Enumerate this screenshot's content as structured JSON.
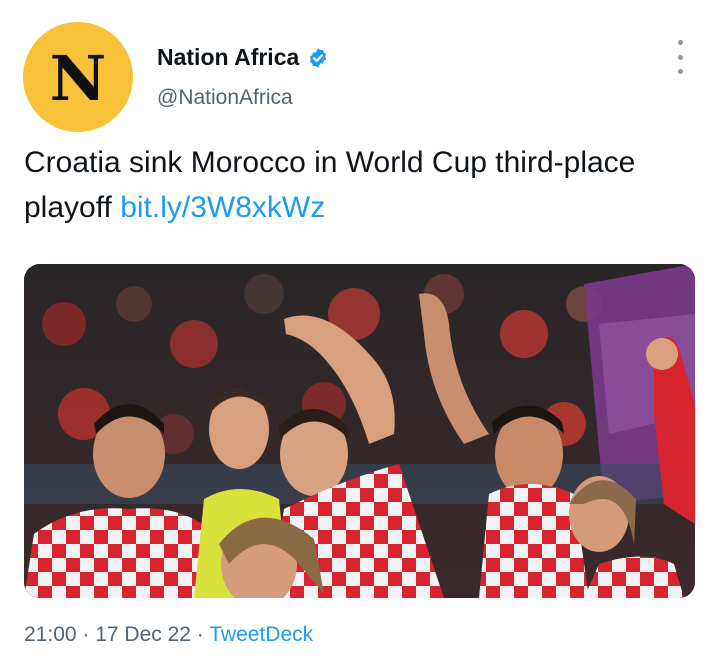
{
  "account": {
    "avatar_letter": "N",
    "display_name": "Nation Africa",
    "handle": "@NationAfrica",
    "verified": true
  },
  "tweet": {
    "text": "Croatia sink Morocco in World Cup third-place playoff ",
    "link": "bit.ly/3W8xkWz"
  },
  "meta": {
    "time": "21:00",
    "date": "17 Dec 22",
    "separator": " · ",
    "source": "TweetDeck"
  },
  "colors": {
    "link": "#1d9bf0",
    "verified_badge": "#1d9bf0",
    "avatar_bg": "#f7c23a",
    "secondary_text": "#536471"
  },
  "icons": {
    "verified": "verified-badge-icon",
    "more": "more-options-icon"
  }
}
